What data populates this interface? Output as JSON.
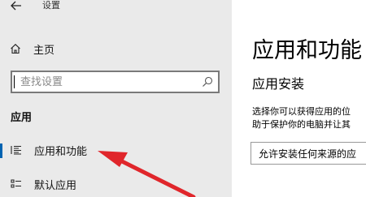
{
  "window": {
    "title": "设置",
    "back_icon": "arrow-left-icon"
  },
  "sidebar": {
    "home_label": "主页",
    "home_icon": "home-icon",
    "search_placeholder": "查找设置",
    "search_icon": "search-icon",
    "section_title": "应用",
    "items": [
      {
        "label": "应用和功能",
        "icon": "list-icon",
        "active": true
      },
      {
        "label": "默认应用",
        "icon": "list-default-icon",
        "active": false
      }
    ]
  },
  "main": {
    "title": "应用和功能",
    "subheading": "应用安装",
    "description_line1": "选择你可以获得应用的位",
    "description_line2": "助于保护你的电脑并让其",
    "dropdown_value": "允许安装任何来源的应"
  },
  "colors": {
    "accent": "#0063b1",
    "annotation_arrow": "#e0262b",
    "sidebar_bg": "#eaeaea"
  }
}
